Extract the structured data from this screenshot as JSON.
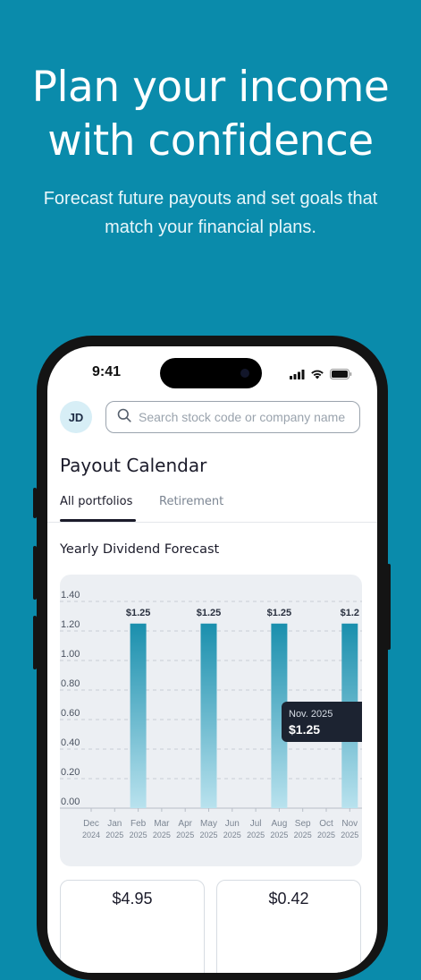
{
  "hero": {
    "title_line1": "Plan your income",
    "title_line2": "with confidence",
    "subtitle_line1": "Forecast future payouts and set goals that",
    "subtitle_line2": "match your financial plans."
  },
  "status_bar": {
    "time": "9:41"
  },
  "header": {
    "avatar_initials": "JD",
    "search_placeholder": "Search stock code or company name"
  },
  "page": {
    "title": "Payout Calendar"
  },
  "tabs": [
    {
      "label": "All portfolios",
      "active": true
    },
    {
      "label": "Retirement",
      "active": false
    }
  ],
  "section": {
    "title": "Yearly Dividend Forecast"
  },
  "chart_data": {
    "type": "bar",
    "categories": [
      "Dec 2024",
      "Jan 2025",
      "Feb 2025",
      "Mar 2025",
      "Apr 2025",
      "May 2025",
      "Jun 2025",
      "Jul 2025",
      "Aug 2025",
      "Sep 2025",
      "Oct 2025",
      "Nov 2025"
    ],
    "category_labels": [
      [
        "Dec",
        "2024"
      ],
      [
        "Jan",
        "2025"
      ],
      [
        "Feb",
        "2025"
      ],
      [
        "Mar",
        "2025"
      ],
      [
        "Apr",
        "2025"
      ],
      [
        "May",
        "2025"
      ],
      [
        "Jun",
        "2025"
      ],
      [
        "Jul",
        "2025"
      ],
      [
        "Aug",
        "2025"
      ],
      [
        "Sep",
        "2025"
      ],
      [
        "Oct",
        "2025"
      ],
      [
        "Nov",
        "2025"
      ]
    ],
    "values": [
      0,
      0,
      1.25,
      0,
      0,
      1.25,
      0,
      0,
      1.25,
      0,
      0,
      1.25
    ],
    "bar_labels": [
      "",
      "",
      "$1.25",
      "",
      "",
      "$1.25",
      "",
      "",
      "$1.25",
      "",
      "",
      "$1.2"
    ],
    "yticks": [
      "0.00",
      "0.20",
      "0.40",
      "0.60",
      "0.80",
      "1.00",
      "1.20",
      "1.40"
    ],
    "ylim": [
      0,
      1.4
    ],
    "grid": true,
    "tooltip": {
      "title": "Nov. 2025",
      "value": "$1.25"
    },
    "bar_color_top": "#1a8fad",
    "bar_color_bottom": "#b9e2ee"
  },
  "summary_cards": [
    {
      "value": "$4.95"
    },
    {
      "value": "$0.42"
    }
  ]
}
